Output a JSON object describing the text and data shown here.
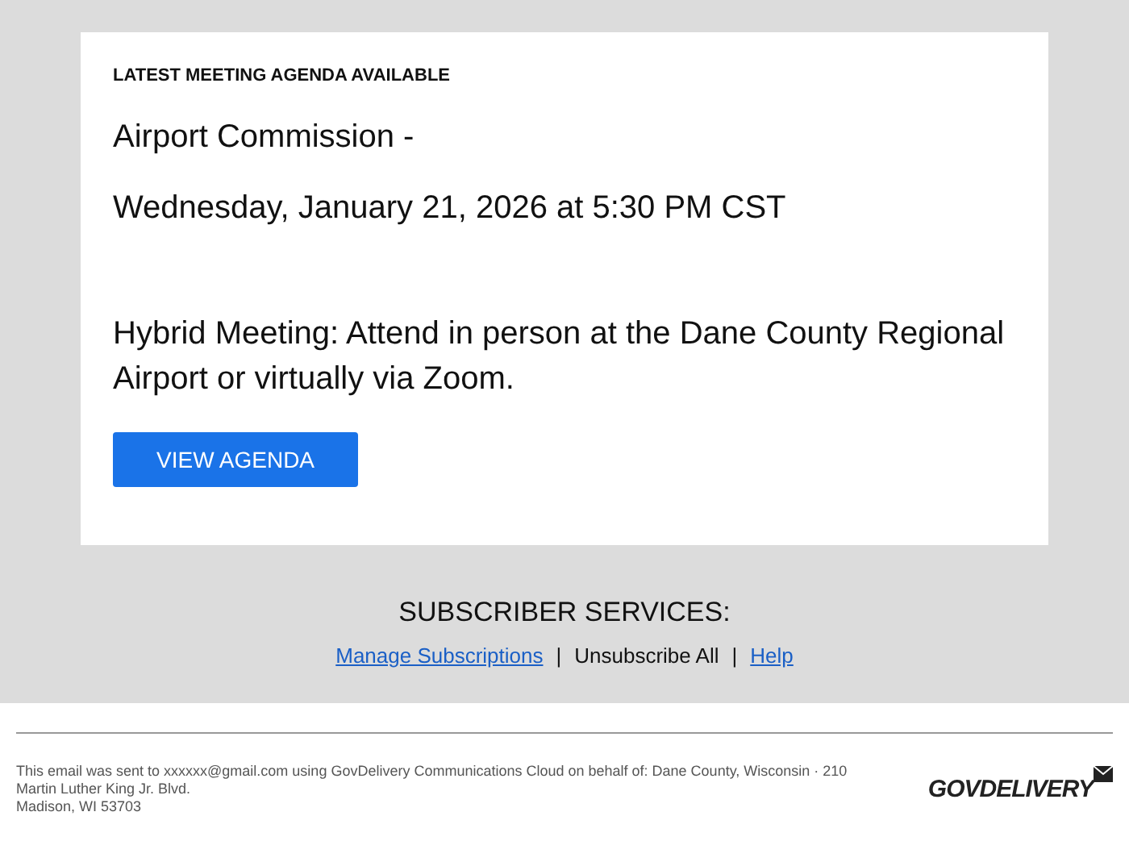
{
  "card": {
    "eyebrow": "LATEST MEETING AGENDA AVAILABLE",
    "title": "Airport Commission -",
    "datetime": "Wednesday, January 21, 2026 at 5:30 PM CST",
    "description": "Hybrid Meeting: Attend in person at the Dane County Regional Airport or virtually via Zoom.",
    "button": "VIEW AGENDA"
  },
  "subscriber_services": {
    "heading": "SUBSCRIBER SERVICES:",
    "links": [
      {
        "label": "Manage Subscriptions",
        "kind": "link"
      },
      {
        "label": "Unsubscribe All",
        "kind": "text"
      },
      {
        "label": "Help",
        "kind": "link"
      }
    ],
    "separator": "|"
  },
  "footer": {
    "lines": [
      "This email was sent to xxxxxx@gmail.com using GovDelivery Communications Cloud on behalf of: Dane County, Wisconsin · 210",
      "Martin Luther King Jr. Blvd.",
      "Madison, WI 53703"
    ],
    "logo": "GOVDELIVERY"
  }
}
